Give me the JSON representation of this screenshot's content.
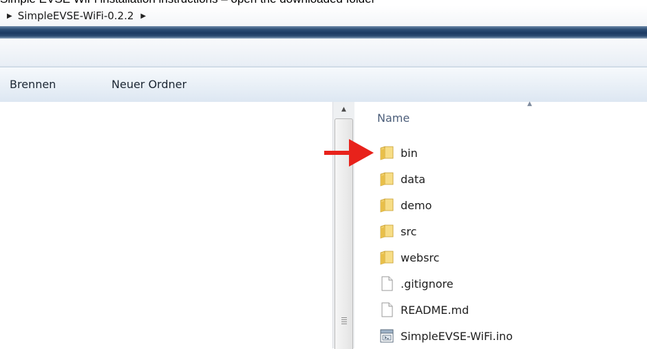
{
  "breadcrumb": {
    "path_label": "SimpleEVSE-WiFi-0.2.2",
    "arrow_left": "▶",
    "arrow_right": "▶"
  },
  "toolbar": {
    "burn_label": "Brennen",
    "new_folder_label": "Neuer Ordner"
  },
  "column_header": {
    "name_label": "Name",
    "sort_indicator": "▲"
  },
  "scrollbar": {
    "up_arrow": "▲"
  },
  "files": [
    {
      "name": "bin",
      "icon": "folder-icon"
    },
    {
      "name": "data",
      "icon": "folder-icon"
    },
    {
      "name": "demo",
      "icon": "folder-icon"
    },
    {
      "name": "src",
      "icon": "folder-icon"
    },
    {
      "name": "websrc",
      "icon": "folder-icon"
    },
    {
      "name": ".gitignore",
      "icon": "file-icon"
    },
    {
      "name": "README.md",
      "icon": "file-icon"
    },
    {
      "name": "SimpleEVSE-WiFi.ino",
      "icon": "ino-file-icon"
    }
  ],
  "colors": {
    "arrow_red": "#e8221b",
    "folder_yellow": "#f1cf64",
    "header_text": "#4c5e7a"
  }
}
